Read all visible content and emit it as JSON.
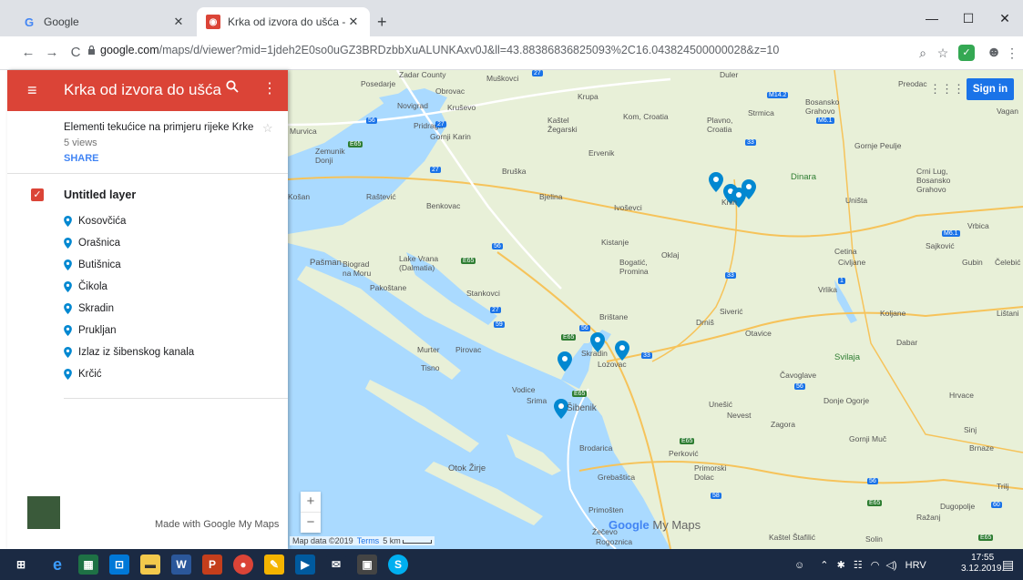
{
  "browser": {
    "tabs": [
      {
        "title": "Google",
        "favicon": "google-g-icon"
      },
      {
        "title": "Krka od izvora do ušća - Google",
        "favicon": "my-maps-icon"
      }
    ],
    "new_tab": "+",
    "url_host": "google.com",
    "url_rest": "/maps/d/viewer?mid=1jdeh2E0so0uGZ3BRDzbbXuALUNKAxv0J&ll=43.88386836825093%2C16.043824500000028&z=10",
    "icons": [
      "back-icon",
      "forward-icon",
      "reload-icon",
      "lock-icon",
      "zoom-icon",
      "star-icon",
      "extension-icon",
      "profile-icon",
      "more-icon"
    ]
  },
  "panel": {
    "title": "Krka od izvora do ušća",
    "description": "Elementi tekućice na primjeru rijeke Krke",
    "views": "5 views",
    "share": "SHARE",
    "layer_name": "Untitled layer",
    "items": [
      {
        "label": "Kosovčića"
      },
      {
        "label": "Orašnica"
      },
      {
        "label": "Butišnica"
      },
      {
        "label": "Čikola"
      },
      {
        "label": "Skradin"
      },
      {
        "label": "Prukljan"
      },
      {
        "label": "Izlaz iz šibenskog kanala"
      },
      {
        "label": "Krčić"
      }
    ],
    "made_with": "Made with Google My Maps"
  },
  "map": {
    "sign_in": "Sign in",
    "attribution": "Map data ©2019",
    "terms": "Terms",
    "scale": "5 km",
    "logo_google": "Google",
    "logo_mymaps": "My Maps",
    "marker_color": "#0288d1",
    "labels": [
      "Zadar County",
      "Posedarje",
      "Obrovac",
      "Muškovci",
      "Novigrad",
      "Kruševo",
      "Krupa",
      "Duler",
      "Bosansko Grahovo",
      "Strmica",
      "Preodac",
      "Vagan",
      "Murvica",
      "Pridraga",
      "Gornji Karin",
      "Kaštel Žegarski",
      "Kom, Croatia",
      "Plavno, Croatia",
      "Zemunik Donji",
      "Ervenik",
      "Gornje Peulje",
      "Bruška",
      "Crni Lug, Bosansko Grahovo",
      "Dinara",
      "Košan",
      "Raštević",
      "Benkovac",
      "Bjelina",
      "Ivoševci",
      "Knin",
      "Uništa",
      "Vrbica",
      "Kistanje",
      "Oklaj",
      "Cetina",
      "Sajković",
      "Pašman",
      "Biograd na Moru",
      "Lake Vrana (Dalmatia)",
      "Bogatić, Promina",
      "Civljane",
      "Gubin",
      "Čelebić",
      "Pakoštane",
      "Stankovci",
      "Vrlika",
      "Koljane",
      "Lištani",
      "Brištane",
      "Drniš",
      "Siverić",
      "Otavice",
      "Dabar",
      "Murter",
      "Pirovac",
      "Skradin",
      "Lozovac",
      "Tisno",
      "Svilaja",
      "Čavoglave",
      "Vodice",
      "Srima",
      "Šibenik",
      "Unešić",
      "Nevest",
      "Donje Ogorje",
      "Hrvace",
      "Zagora",
      "Sinj",
      "Gornji Muč",
      "Brnaze",
      "Brodarica",
      "Perković",
      "Otok Žirje",
      "Primorski Dolac",
      "Grebaštica",
      "Trilj",
      "Primošten",
      "Dugopolje",
      "Ražanj",
      "Rogoznica",
      "Kaštel Štafilić",
      "Solin",
      "Žečevo"
    ]
  },
  "taskbar": {
    "apps": [
      "windows-icon",
      "edge-icon",
      "sheets-icon",
      "store-icon",
      "explorer-icon",
      "word-icon",
      "outlook-icon",
      "chrome-icon",
      "paint-icon",
      "media-icon",
      "mail-icon",
      "app-icon",
      "skype-icon"
    ],
    "lang": "HRV",
    "time": "17:55",
    "date": "3.12.2019."
  }
}
